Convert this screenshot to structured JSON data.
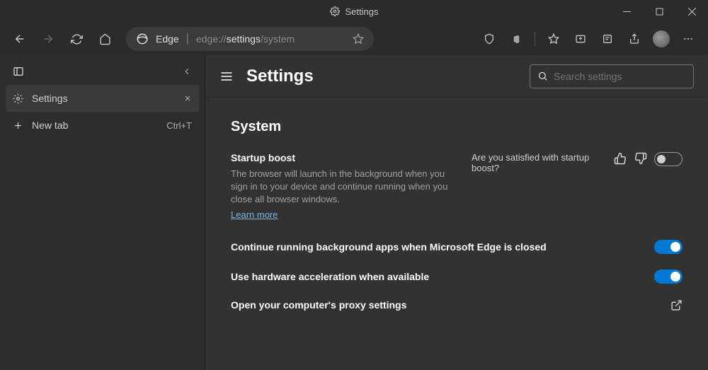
{
  "window": {
    "title": "Settings"
  },
  "address": {
    "brand": "Edge",
    "url_dim1": "edge://",
    "url_hl": "settings",
    "url_dim2": "/system"
  },
  "sidebar": {
    "settings_label": "Settings",
    "newtab_label": "New tab",
    "newtab_shortcut": "Ctrl+T"
  },
  "page": {
    "title": "Settings",
    "search_placeholder": "Search settings",
    "section_title": "System",
    "startup": {
      "label": "Startup boost",
      "desc": "The browser will launch in the background when you sign in to your device and continue running when you close all browser windows.",
      "learn": "Learn more",
      "feedback_q": "Are you satisfied with startup boost?"
    },
    "bg_apps": "Continue running background apps when Microsoft Edge is closed",
    "hw_accel": "Use hardware acceleration when available",
    "proxy": "Open your computer's proxy settings"
  },
  "toggles": {
    "startup": false,
    "bg_apps": true,
    "hw_accel": true
  }
}
